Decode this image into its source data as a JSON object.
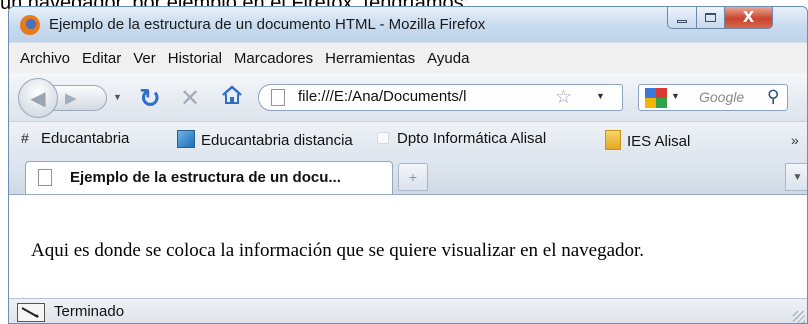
{
  "article": {
    "text": "un navegador, por ejemplo en el Firefox, tendríamos:"
  },
  "window": {
    "title": "Ejemplo de la estructura de un documento HTML - Mozilla Firefox",
    "controls": {
      "minimize": "minimize",
      "maximize": "maximize",
      "close": "X"
    }
  },
  "menubar": {
    "items": [
      "Archivo",
      "Editar",
      "Ver",
      "Historial",
      "Marcadores",
      "Herramientas",
      "Ayuda"
    ]
  },
  "navbar": {
    "url": "file:///E:/Ana/Documents/l",
    "search_placeholder": "Google",
    "icons": [
      "back-icon",
      "forward-icon",
      "reload-icon",
      "stop-icon",
      "home-icon",
      "star-icon",
      "search-icon"
    ]
  },
  "bookmarks": {
    "items": [
      {
        "label": "Educantabria",
        "icon": "grid-icon"
      },
      {
        "label": "Educantabria distancia",
        "icon": "page-icon"
      },
      {
        "label": "Dpto Informática Alisal",
        "icon": "blank-icon"
      },
      {
        "label": "IES Alisal",
        "icon": "folder-icon"
      }
    ],
    "overflow": "»"
  },
  "tabs": {
    "active_title": "Ejemplo de la estructura de un docu...",
    "new_tab": "+"
  },
  "content": {
    "text": "Aqui es donde se coloca la información que se quiere visualizar en el navegador."
  },
  "statusbar": {
    "text": "Terminado"
  },
  "colors": {
    "window_frame": "#c9dcf0",
    "close_button": "#c8452e",
    "reload_blue": "#2f6fc6"
  }
}
